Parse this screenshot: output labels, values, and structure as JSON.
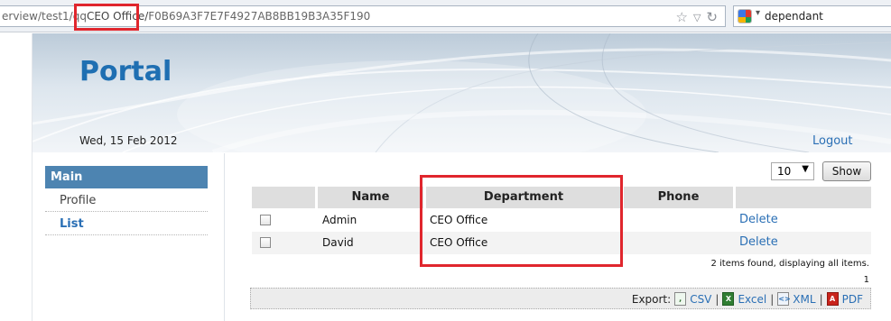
{
  "browser": {
    "url_prefix": "erview/test1/qq",
    "url_highlight": "CEO Office/",
    "url_suffix": "F0B69A3F7E7F4927AB8BB19B3A35F190",
    "search_query": "dependant"
  },
  "header": {
    "title": "Portal",
    "date": "Wed, 15 Feb 2012",
    "logout_label": "Logout"
  },
  "sidebar": {
    "section": "Main",
    "items": [
      {
        "label": "Profile"
      },
      {
        "label": "List"
      }
    ]
  },
  "pager": {
    "page_size": "10",
    "show_label": "Show"
  },
  "table": {
    "columns": [
      "",
      "Name",
      "Department",
      "Phone",
      ""
    ],
    "rows": [
      {
        "name": "Admin",
        "department": "CEO Office",
        "phone": "",
        "action": "Delete"
      },
      {
        "name": "David",
        "department": "CEO Office",
        "phone": "",
        "action": "Delete"
      }
    ],
    "summary": "2 items found, displaying all items.",
    "page": "1"
  },
  "export": {
    "label": "Export:",
    "csv": "CSV",
    "excel": "Excel",
    "xml": "XML",
    "pdf": "PDF",
    "separator": "|"
  },
  "colors": {
    "accent": "#2a6fb5",
    "nav_header": "#4d84b1",
    "highlight_box": "#e0262d"
  }
}
